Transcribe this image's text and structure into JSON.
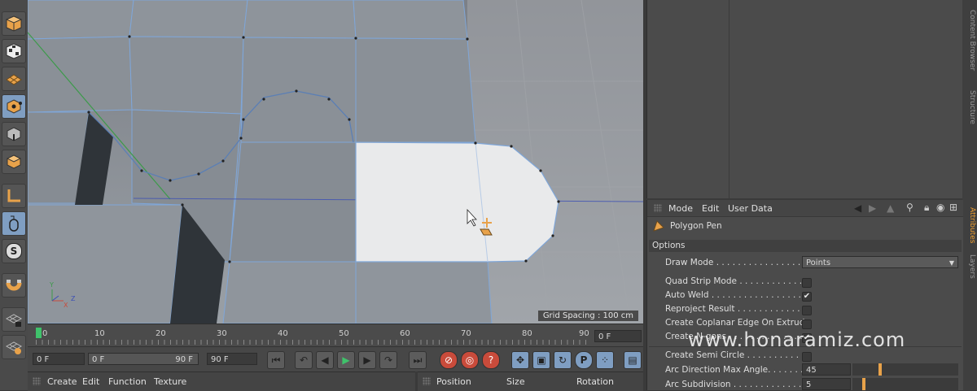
{
  "left_toolbar": {
    "tools": [
      {
        "icon": "cube-object-icon"
      },
      {
        "icon": "checker-cube-icon"
      },
      {
        "icon": "texture-mode-icon"
      },
      {
        "icon": "point-mode-icon"
      },
      {
        "icon": "edge-mode-icon"
      },
      {
        "icon": "polygon-mode-icon"
      },
      {
        "icon": "axis-icon"
      },
      {
        "icon": "tweak-mode-icon"
      },
      {
        "icon": "solo-icon"
      },
      {
        "icon": "magnet-snap-icon"
      },
      {
        "icon": "workplane-lock-icon"
      },
      {
        "icon": "workplane-icon"
      }
    ],
    "solo_label": "S"
  },
  "viewport": {
    "grid_spacing": "Grid Spacing : 100 cm",
    "axis_x": "X",
    "axis_y": "Y",
    "axis_z": "Z"
  },
  "timeline": {
    "ticks": [
      "0",
      "10",
      "20",
      "30",
      "40",
      "50",
      "60",
      "70",
      "80",
      "90"
    ],
    "current_frame_field": "0 F"
  },
  "playback": {
    "start_field": "0 F",
    "range_start": "0 F",
    "range_end": "90 F",
    "end_field": "90 F",
    "param_button_label": "P"
  },
  "materials_menu": {
    "items": [
      "Create",
      "Edit",
      "Function",
      "Texture"
    ]
  },
  "coords_menu": {
    "items": [
      "Position",
      "Size",
      "Rotation"
    ]
  },
  "right_tabs": [
    "Content Browser",
    "Structure",
    "Attributes",
    "Layers"
  ],
  "attributes": {
    "menu": [
      "Mode",
      "Edit",
      "User Data"
    ],
    "tool_name": "Polygon Pen",
    "section": "Options",
    "draw_mode_label": "Draw Mode . . . . . . . . . . . . . . . . . . .",
    "draw_mode_value": "Points",
    "options": [
      {
        "label": "Quad Strip Mode . . . . . . . . . . . . .",
        "checked": false
      },
      {
        "label": "Auto Weld . . . . . . . . . . . . . . . . . . .",
        "checked": true
      },
      {
        "label": "Reproject Result . . . . . . . . . . . . .",
        "checked": false
      },
      {
        "label": "Create Coplanar Edge On Extrude",
        "checked": false
      },
      {
        "label": "Create N-gons . . . . . . . . . . . . . . .",
        "checked": true
      }
    ],
    "semi_circle_label": "Create Semi Circle . . . . . . . . . . . .",
    "semi_circle_checked": false,
    "arc_angle_label": "Arc Direction Max Angle. . . . . . . .",
    "arc_angle_value": "45",
    "arc_subdiv_label": "Arc Subdivision . . . . . . . . . . . . . .",
    "arc_subdiv_value": "5",
    "check_mark": "✔"
  },
  "watermark": "www.honaramiz.com"
}
